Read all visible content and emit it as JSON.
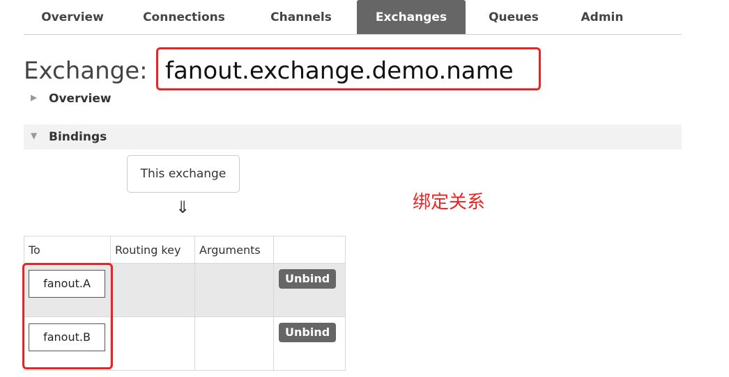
{
  "nav": {
    "items": [
      {
        "label": "Overview",
        "active": false
      },
      {
        "label": "Connections",
        "active": false
      },
      {
        "label": "Channels",
        "active": false
      },
      {
        "label": "Exchanges",
        "active": true
      },
      {
        "label": "Queues",
        "active": false
      },
      {
        "label": "Admin",
        "active": false
      }
    ]
  },
  "page": {
    "title_prefix": "Exchange:",
    "exchange_name": "fanout.exchange.demo.name"
  },
  "sections": {
    "overview": {
      "label": "Overview",
      "expanded": false,
      "icon": "triangle-right-icon"
    },
    "bindings": {
      "label": "Bindings",
      "expanded": true,
      "icon": "triangle-down-icon"
    }
  },
  "bindings": {
    "source_label": "This exchange",
    "arrow": "⇓",
    "annotation": "绑定关系",
    "columns": [
      "To",
      "Routing key",
      "Arguments",
      ""
    ],
    "rows": [
      {
        "to": "fanout.A",
        "routing_key": "",
        "arguments": "",
        "action": "Unbind"
      },
      {
        "to": "fanout.B",
        "routing_key": "",
        "arguments": "",
        "action": "Unbind"
      }
    ]
  },
  "colors": {
    "accent_highlight": "#ee2222",
    "active_tab": "#666666"
  }
}
